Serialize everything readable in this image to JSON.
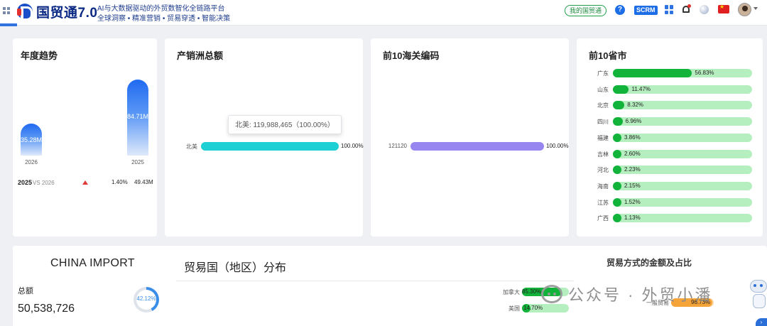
{
  "header": {
    "brand": "国贸通7.0",
    "tagline_1": "AI与大数据驱动的外贸数智化全链路平台",
    "tagline_2": "全球洞察 • 精准营销 • 贸易穿透 • 智能决策",
    "my_button": "我的国贸通",
    "help_icon_glyph": "?",
    "scrm_label": "SCRM",
    "icons": [
      "grid-icon",
      "apps-icon",
      "bell-icon",
      "globe-icon",
      "flag-cn-icon",
      "avatar"
    ]
  },
  "trend": {
    "title": "年度趋势",
    "bars": [
      {
        "year": "2026",
        "label": "35.28M",
        "value": 35.28
      },
      {
        "year": "2025",
        "label": "84.71M",
        "value": 84.71
      }
    ],
    "compare_year": "2025",
    "compare_vs": "VS 2026",
    "change_pct": "1.40%",
    "change_value": "49.43M",
    "trend_direction": "up"
  },
  "continent": {
    "title": "产销洲总额",
    "tooltip": "北美: 119,988,465（100.00%）",
    "categories": [
      "北美"
    ],
    "values_pct": [
      100.0
    ],
    "value_labels": [
      "100.00%"
    ],
    "bar_color": "#1ed0d4"
  },
  "hscode": {
    "title": "前10海关编码",
    "categories": [
      "121120"
    ],
    "values_pct": [
      100.0
    ],
    "value_labels": [
      "100.00%"
    ],
    "bar_color": "#9886f0"
  },
  "provinces": {
    "title": "前10省市",
    "items": [
      {
        "name": "广东",
        "pct": 56.83,
        "label": "56.83%"
      },
      {
        "name": "山东",
        "pct": 11.47,
        "label": "11.47%"
      },
      {
        "name": "北京",
        "pct": 8.32,
        "label": "8.32%"
      },
      {
        "name": "四川",
        "pct": 6.96,
        "label": "6.96%"
      },
      {
        "name": "福建",
        "pct": 3.86,
        "label": "3.86%"
      },
      {
        "name": "吉林",
        "pct": 2.6,
        "label": "2.60%"
      },
      {
        "name": "河北",
        "pct": 2.23,
        "label": "2.23%"
      },
      {
        "name": "海南",
        "pct": 2.15,
        "label": "2.15%"
      },
      {
        "name": "江苏",
        "pct": 1.52,
        "label": "1.52%"
      },
      {
        "name": "广西",
        "pct": 1.13,
        "label": "1.13%"
      }
    ]
  },
  "china_import": {
    "title": "CHINA IMPORT",
    "total_label": "总额",
    "total_value": "50,538,726",
    "share_pct": 42.12,
    "share_label": "42.12%"
  },
  "trade_country": {
    "title": "贸易国（地区）分布",
    "items": [
      {
        "name": "加拿大",
        "pct": 85.3,
        "label": "85.30%"
      },
      {
        "name": "美国",
        "pct": 14.7,
        "label": "14.70%"
      }
    ]
  },
  "trade_mode": {
    "title": "贸易方式的金额及占比",
    "items": [
      {
        "name": "一般贸易",
        "pct": 96.73,
        "label": "96.73%"
      }
    ]
  },
  "watermark": {
    "text": "公众号 · 外贸小潘"
  }
}
